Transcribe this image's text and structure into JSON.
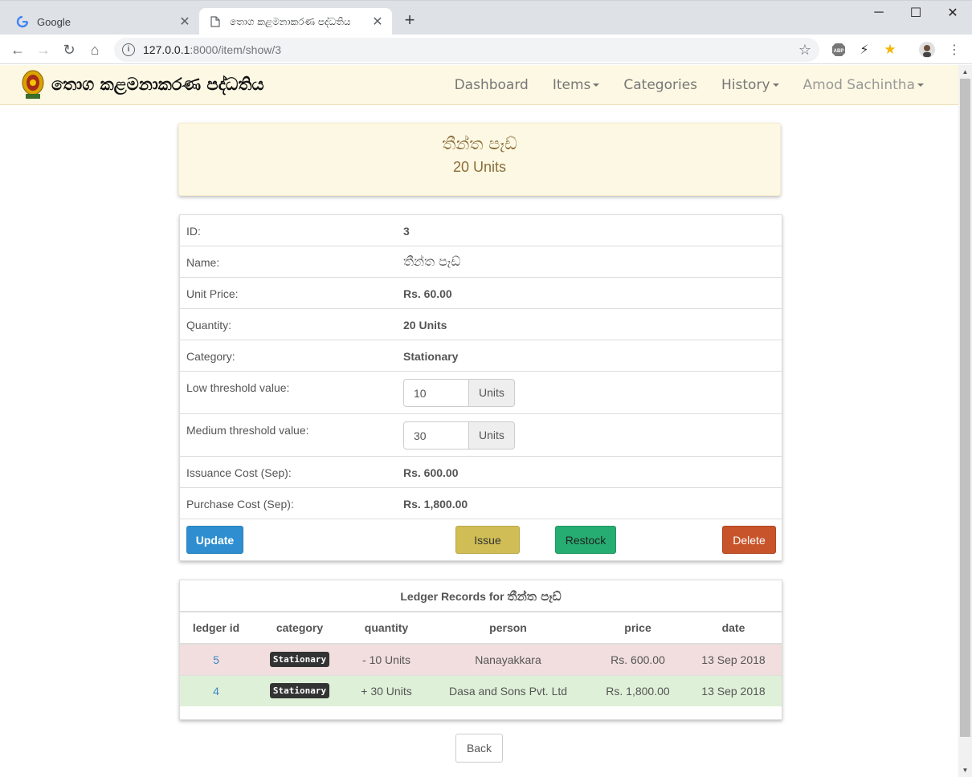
{
  "browser": {
    "tabs": [
      {
        "title": "Google",
        "icon": "google-icon"
      },
      {
        "title": "තොග කළමනාකරණ පද්ධතිය",
        "icon": "page-icon"
      }
    ],
    "url": {
      "host": "127.0.0.1",
      "path": ":8000/item/show/3"
    }
  },
  "navbar": {
    "brand": "තොග කළමනාකරණ පද්ධතිය",
    "links": {
      "dashboard": "Dashboard",
      "items": "Items",
      "categories": "Categories",
      "history": "History",
      "user": "Amod Sachintha"
    }
  },
  "header": {
    "name": "තීන්ත පෑඩ්",
    "quantity": "20 Units"
  },
  "details": {
    "id": {
      "label": "ID:",
      "value": "3"
    },
    "name": {
      "label": "Name:",
      "value": "තීන්ත පෑඩ්"
    },
    "unit_price": {
      "label": "Unit Price:",
      "value": "Rs. 60.00"
    },
    "quantity": {
      "label": "Quantity:",
      "value": "20 Units"
    },
    "category": {
      "label": "Category:",
      "value": "Stationary"
    },
    "low_threshold": {
      "label": "Low threshold value:",
      "value": "10",
      "addon": "Units"
    },
    "medium_threshold": {
      "label": "Medium threshold value:",
      "value": "30",
      "addon": "Units"
    },
    "issuance_cost": {
      "label": "Issuance Cost (Sep):",
      "value": "Rs. 600.00"
    },
    "purchase_cost": {
      "label": "Purchase Cost (Sep):",
      "value": "Rs. 1,800.00"
    }
  },
  "actions": {
    "update": "Update",
    "issue": "Issue",
    "restock": "Restock",
    "delete": "Delete"
  },
  "ledger": {
    "title_prefix": "Ledger Records for ",
    "title_item": "තීන්ත පෑඩ්",
    "columns": [
      "ledger id",
      "category",
      "quantity",
      "person",
      "price",
      "date"
    ],
    "rows": [
      {
        "id": "5",
        "category": "Stationary",
        "quantity": "- 10 Units",
        "person": "Nanayakkara",
        "price": "Rs. 600.00",
        "date": "13 Sep 2018",
        "status": "danger"
      },
      {
        "id": "4",
        "category": "Stationary",
        "quantity": "+ 30 Units",
        "person": "Dasa and Sons Pvt. Ltd",
        "price": "Rs. 1,800.00",
        "date": "13 Sep 2018",
        "status": "success"
      }
    ]
  },
  "back": "Back",
  "colors": {
    "accent": "#2e8ecf",
    "warning_bg": "#fcf8e3",
    "danger_row": "#f2dede",
    "success_row": "#dff0d8"
  }
}
